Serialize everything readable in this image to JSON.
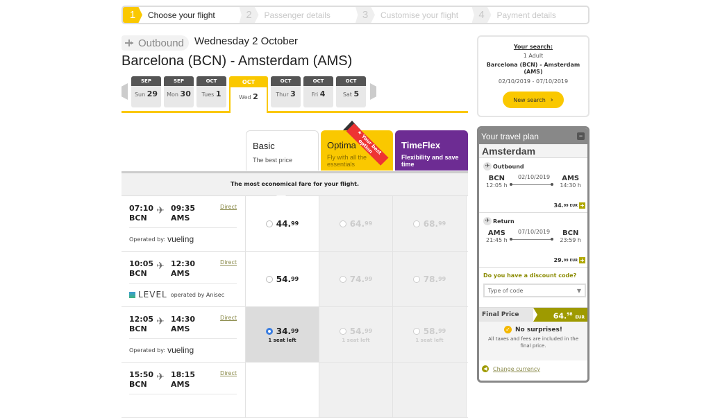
{
  "steps": [
    {
      "num": "1",
      "label": "Choose your flight",
      "active": true
    },
    {
      "num": "2",
      "label": "Passenger details",
      "active": false
    },
    {
      "num": "3",
      "label": "Customise your flight",
      "active": false
    },
    {
      "num": "4",
      "label": "Payment details",
      "active": false
    }
  ],
  "outbound": {
    "tag": "Outbound",
    "date": "Wednesday 2 October",
    "route": "Barcelona (BCN) - Amsterdam (AMS)"
  },
  "dates": [
    {
      "month": "SEP",
      "weekday": "Sun",
      "day": "29"
    },
    {
      "month": "SEP",
      "weekday": "Mon",
      "day": "30"
    },
    {
      "month": "OCT",
      "weekday": "Tues",
      "day": "1"
    },
    {
      "month": "OCT",
      "weekday": "Wed",
      "day": "2"
    },
    {
      "month": "OCT",
      "weekday": "Thur",
      "day": "3"
    },
    {
      "month": "OCT",
      "weekday": "Fri",
      "day": "4"
    },
    {
      "month": "OCT",
      "weekday": "Sat",
      "day": "5"
    }
  ],
  "fares": {
    "basic": {
      "title": "Basic",
      "subtitle": "The best price"
    },
    "optima": {
      "title": "Optima",
      "subtitle": "Fly with all the essentials",
      "ribbon": "★ Your best option"
    },
    "timeflex": {
      "title": "TimeFlex",
      "subtitle": "Flexibility and save time"
    }
  },
  "eco_banner": "The most economical fare for your flight.",
  "flights": [
    {
      "dep_time": "07:10",
      "dep": "BCN",
      "arr_time": "09:35",
      "arr": "AMS",
      "direct": "Direct",
      "operator_prefix": "Operated by:",
      "operator": "vueling",
      "operator_type": "vueling",
      "prices": [
        {
          "int": "44.",
          "dec": "99",
          "seat": ""
        },
        {
          "int": "64.",
          "dec": "99",
          "seat": ""
        },
        {
          "int": "68.",
          "dec": "99",
          "seat": ""
        }
      ]
    },
    {
      "dep_time": "10:05",
      "dep": "BCN",
      "arr_time": "12:30",
      "arr": "AMS",
      "direct": "Direct",
      "operator_prefix": "LEVEL",
      "operator": "operated by Anisec",
      "operator_type": "level",
      "prices": [
        {
          "int": "54.",
          "dec": "99",
          "seat": ""
        },
        {
          "int": "74.",
          "dec": "99",
          "seat": ""
        },
        {
          "int": "78.",
          "dec": "99",
          "seat": ""
        }
      ]
    },
    {
      "dep_time": "12:05",
      "dep": "BCN",
      "arr_time": "14:30",
      "arr": "AMS",
      "direct": "Direct",
      "operator_prefix": "Operated by:",
      "operator": "vueling",
      "operator_type": "vueling",
      "prices": [
        {
          "int": "34.",
          "dec": "99",
          "seat": "1 seat left"
        },
        {
          "int": "54.",
          "dec": "99",
          "seat": "1 seat left"
        },
        {
          "int": "58.",
          "dec": "99",
          "seat": "1 seat left"
        }
      ]
    },
    {
      "dep_time": "15:50",
      "dep": "BCN",
      "arr_time": "18:15",
      "arr": "AMS",
      "direct": "Direct",
      "operator_prefix": "",
      "operator": "",
      "operator_type": "",
      "prices": [
        {
          "int": "",
          "dec": "",
          "seat": ""
        },
        {
          "int": "",
          "dec": "",
          "seat": ""
        },
        {
          "int": "",
          "dec": "",
          "seat": ""
        }
      ]
    }
  ],
  "selected_flight": 2,
  "search": {
    "heading": "Your search:",
    "adults": "1 Adult",
    "route": "Barcelona (BCN) - Amsterdam (AMS)",
    "dates": "02/10/2019 - 07/10/2019",
    "button": "New search"
  },
  "plan": {
    "title": "Your travel plan",
    "minimize": "−",
    "city": "Amsterdam",
    "outbound": {
      "label": "Outbound",
      "from": "BCN",
      "from_time": "12:05 h",
      "date": "02/10/2019",
      "to": "AMS",
      "to_time": "14:30 h",
      "price_int": "34.",
      "price_dec": "99",
      "currency": "EUR"
    },
    "return": {
      "label": "Return",
      "from": "AMS",
      "from_time": "21:45 h",
      "date": "07/10/2019",
      "to": "BCN",
      "to_time": "23:59 h",
      "price_int": "29.",
      "price_dec": "99",
      "currency": "EUR"
    },
    "discount_q": "Do you have a discount code?",
    "code_placeholder": "Type of code",
    "final_label": "Final Price",
    "final_int": "64.",
    "final_dec": "98",
    "final_currency": "EUR",
    "no_surprises": "No surprises!",
    "no_surprises_text": "All taxes and fees are included in the final price.",
    "change_currency": "Change currency"
  }
}
